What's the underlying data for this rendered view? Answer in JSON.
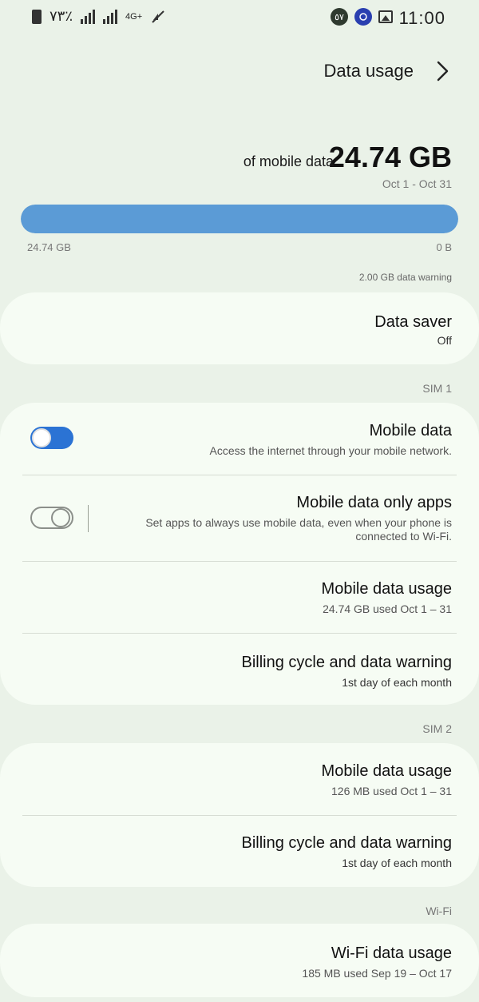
{
  "status_bar": {
    "time": "11:00",
    "badge_number": "٥٧",
    "battery_percent": "٧٣٪",
    "network_type": "4G+"
  },
  "header": {
    "title": "Data usage"
  },
  "summary": {
    "amount": "24.74 GB",
    "of_label": "of mobile data",
    "period": "Oct 1 - Oct 31",
    "bar_min": "0 B",
    "bar_max": "24.74 GB",
    "bar_fill_fraction": 1.0,
    "warning": "2.00 GB data warning"
  },
  "data_saver": {
    "title": "Data saver",
    "status": "Off"
  },
  "sim1": {
    "label": "SIM 1",
    "mobile_data": {
      "title": "Mobile data",
      "subtitle": "Access the internet through your mobile network.",
      "enabled": true
    },
    "mobile_data_only_apps": {
      "title": "Mobile data only apps",
      "subtitle_line1": "Set apps to always use mobile data, even when your phone is",
      "subtitle_line2": "connected to Wi-Fi.",
      "enabled": false
    },
    "mobile_data_usage": {
      "title": "Mobile data usage",
      "subtitle": "24.74 GB used Oct 1 – 31"
    },
    "billing": {
      "title": "Billing cycle and data warning",
      "subtitle": "1st day of each month"
    }
  },
  "sim2": {
    "label": "SIM 2",
    "mobile_data_usage": {
      "title": "Mobile data usage",
      "subtitle": "126 MB used Oct 1 – 31"
    },
    "billing": {
      "title": "Billing cycle and data warning",
      "subtitle": "1st day of each month"
    }
  },
  "wifi": {
    "label": "Wi-Fi",
    "usage": {
      "title": "Wi-Fi data usage",
      "subtitle": "185 MB used Sep 19 – Oct 17"
    }
  },
  "colors": {
    "background": "#eaf2e8",
    "card": "#f6fcf4",
    "accent_blue": "#2b73d4",
    "bar_fill": "#5b9bd6"
  },
  "icons": {
    "back": "chevron-icon",
    "gallery": "image-icon",
    "battery": "battery-icon",
    "signal": "signal-icon",
    "mute": "mute-icon"
  }
}
